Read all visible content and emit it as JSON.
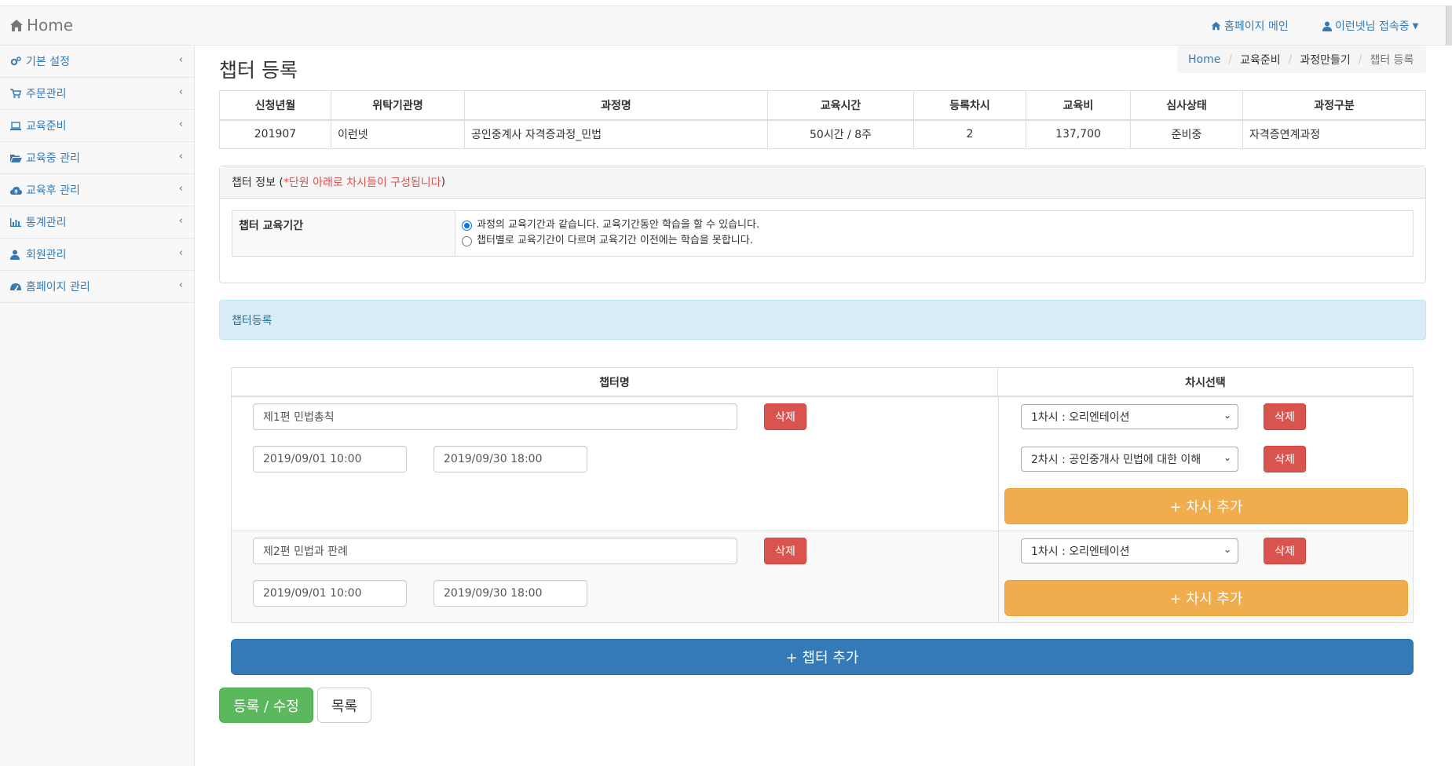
{
  "topnav": {
    "brand": "Home",
    "homepage_main": "홈페이지 메인",
    "user_status": "이런넷님 접속중"
  },
  "sidebar": {
    "items": [
      {
        "label": "기본 설정",
        "icon": "gears-icon"
      },
      {
        "label": "주문관리",
        "icon": "cart-icon"
      },
      {
        "label": "교육준비",
        "icon": "laptop-icon"
      },
      {
        "label": "교육중 관리",
        "icon": "folder-open-icon"
      },
      {
        "label": "교육후 관리",
        "icon": "cloud-upload-icon"
      },
      {
        "label": "통계관리",
        "icon": "bar-chart-icon"
      },
      {
        "label": "회원관리",
        "icon": "user-icon"
      },
      {
        "label": "홈페이지 관리",
        "icon": "dashboard-icon"
      }
    ]
  },
  "page": {
    "title": "챕터 등록",
    "breadcrumb": [
      "Home",
      "교육준비",
      "과정만들기",
      "챕터 등록"
    ]
  },
  "course": {
    "headers": [
      "신청년월",
      "위탁기관명",
      "과정명",
      "교육시간",
      "등록차시",
      "교육비",
      "심사상태",
      "과정구분"
    ],
    "row": [
      "201907",
      "이런넷",
      "공인중계사 자격증과정_민법",
      "50시간 / 8주",
      "2",
      "137,700",
      "준비중",
      "자격증연계과정"
    ]
  },
  "chapter_info": {
    "title": "챕터 정보 (",
    "note": "*단원 아래로 차시들이 구성됩니다",
    "title_end": ")",
    "period_label": "챕터 교육기간",
    "option_same": "과정의 교육기간과 같습니다. 교육기간동안 학습을 할 수 있습니다.",
    "option_diff": "챕터별로 교육기간이 다르며 교육기간 이전에는 학습을 못합니다.",
    "selected": "same"
  },
  "register_alert": "챕터등록",
  "chapter_table": {
    "col_name": "챕터명",
    "col_session": "차시선택",
    "delete_label": "삭제",
    "add_session_label": "+ 차시 추가",
    "chapters": [
      {
        "name": "제1편 민법총칙",
        "start": "2019/09/01 10:00",
        "end": "2019/09/30 18:00",
        "sessions": [
          "1차시 : 오리엔테이션",
          "2차시 : 공인중개사 민법에 대한 이해"
        ]
      },
      {
        "name": "제2편 민법과 판례",
        "start": "2019/09/01 10:00",
        "end": "2019/09/30 18:00",
        "sessions": [
          "1차시 : 오리엔테이션"
        ]
      }
    ]
  },
  "actions": {
    "add_chapter": "+ 챕터 추가",
    "submit": "등록 / 수정",
    "list": "목록"
  }
}
